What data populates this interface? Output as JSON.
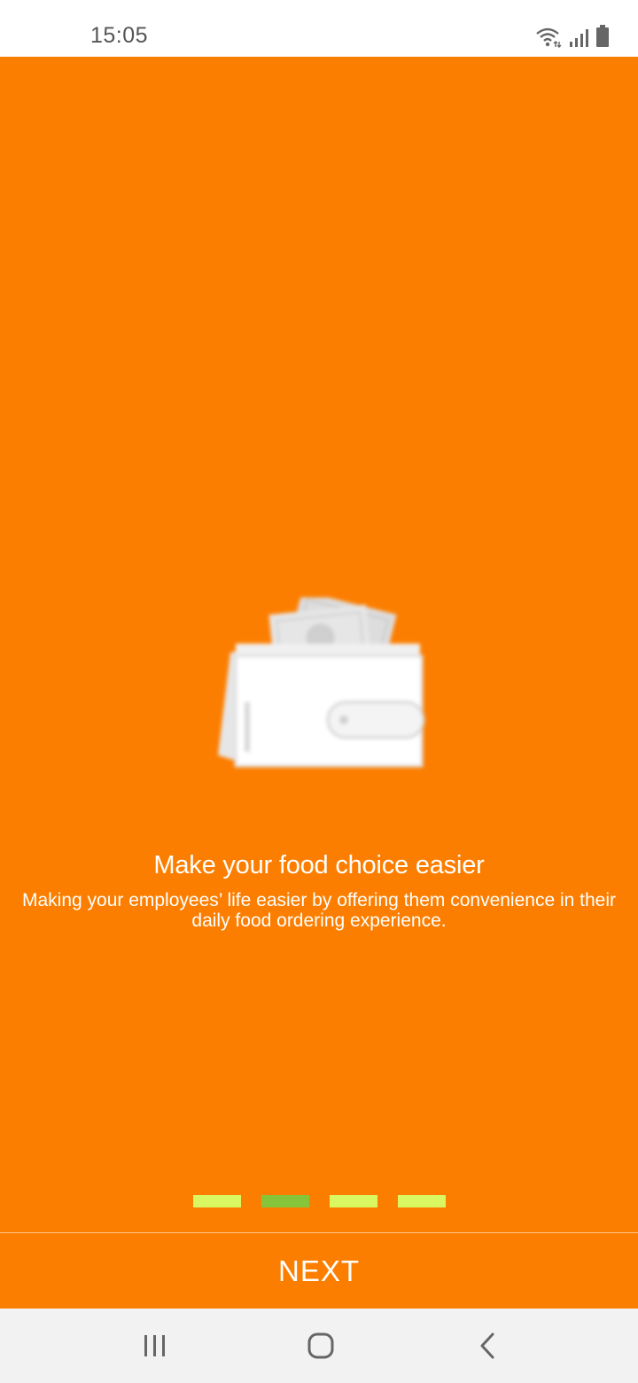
{
  "status_bar": {
    "time": "15:05",
    "icons": [
      "wifi-icon",
      "signal-icon",
      "battery-icon"
    ]
  },
  "onboarding": {
    "illustration": "wallet-icon",
    "title": "Make your food choice easier",
    "description": "Making your employees’ life easier by offering them convenience in their daily food ordering experience.",
    "page_count": 4,
    "active_page": 2
  },
  "actions": {
    "next_label": "NEXT"
  },
  "colors": {
    "background": "#FC7E00",
    "pager_inactive": "#D9F761",
    "pager_active": "#86C43A",
    "text": "#FFFFFF"
  },
  "nav_bar": {
    "buttons": [
      "recent-apps-icon",
      "home-icon",
      "back-icon"
    ]
  }
}
